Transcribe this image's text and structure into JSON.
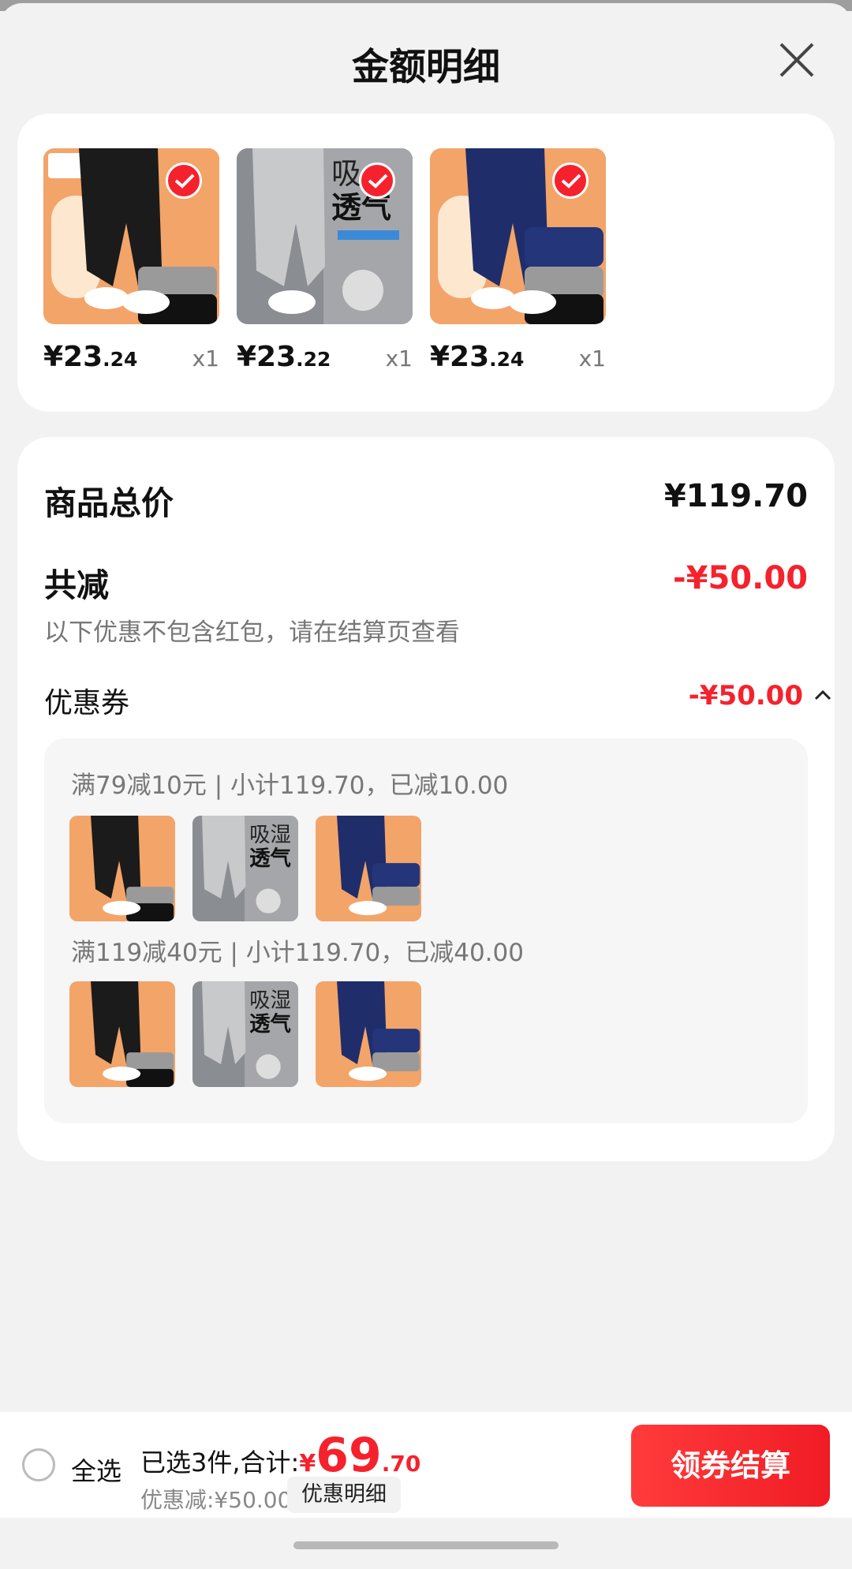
{
  "header": {
    "title": "金额明细"
  },
  "products": [
    {
      "price_main": "¥23",
      "price_dec": ".24",
      "qty": "x1",
      "color": "black"
    },
    {
      "price_main": "¥23",
      "price_dec": ".22",
      "qty": "x1",
      "color": "gray"
    },
    {
      "price_main": "¥23",
      "price_dec": ".24",
      "qty": "x1",
      "color": "navy"
    }
  ],
  "summary": {
    "total_label": "商品总价",
    "total_value": "¥119.70",
    "reduce_label": "共减",
    "reduce_value": "-¥50.00",
    "note": "以下优惠不包含红包，请在结算页查看",
    "coupon_label": "优惠券",
    "coupon_value": "-¥50.00"
  },
  "coupons": [
    {
      "rule": "满79减10元 | 小计119.70，已减10.00"
    },
    {
      "rule": "满119减40元 | 小计119.70，已减40.00"
    }
  ],
  "bottom": {
    "select_all": "全选",
    "selected_text": "已选3件,合计:",
    "total_currency": "¥",
    "total_main": "69",
    "total_dec": ".70",
    "discount": "优惠减:¥50.00",
    "detail_button": "优惠明细",
    "checkout_button": "领券结算"
  },
  "colors": {
    "accent": "#f5222d",
    "image_bg_orange": "#f3a469",
    "image_bg_gray": "#8a8d92"
  }
}
